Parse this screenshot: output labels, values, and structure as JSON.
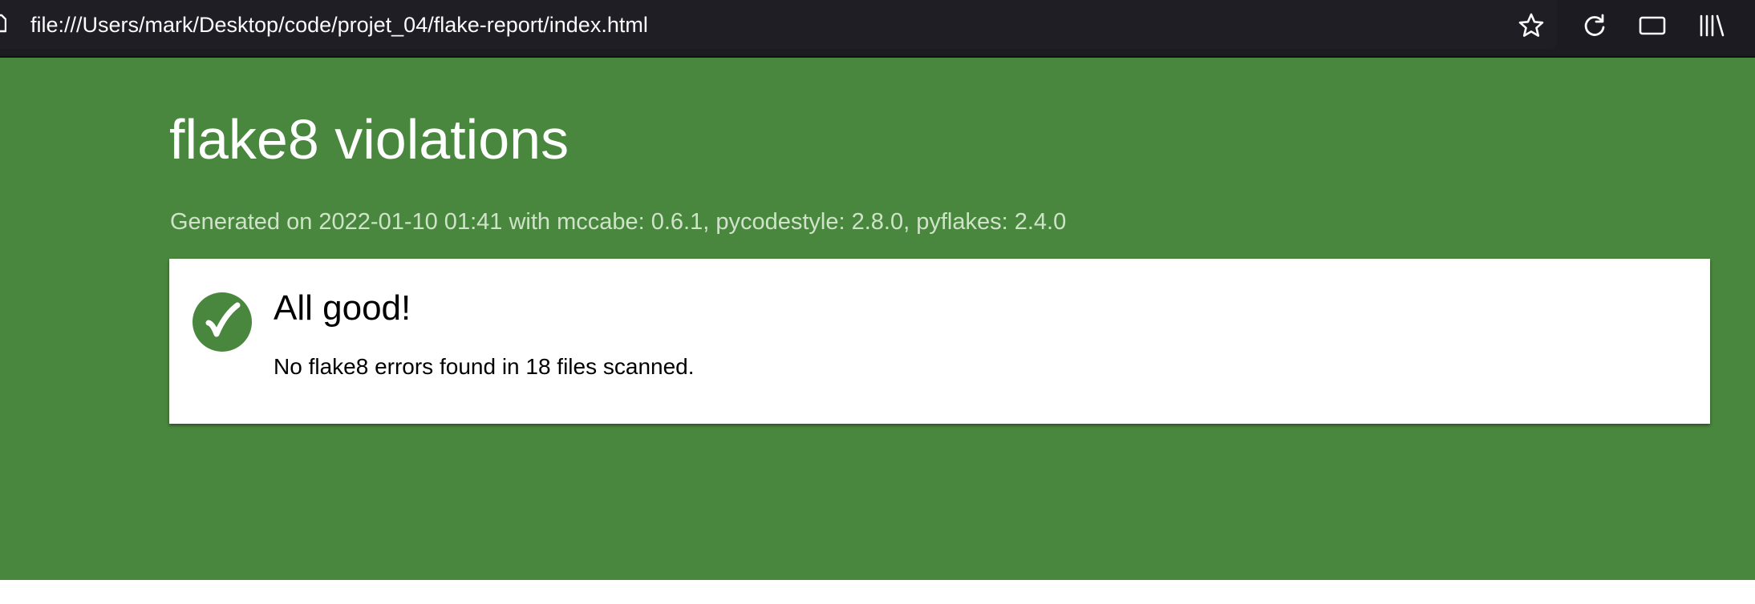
{
  "browser": {
    "url": "file:///Users/mark/Desktop/code/projet_04/flake-report/index.html",
    "icons": {
      "page": "page-icon",
      "bookmark": "star-icon",
      "reload": "reload-icon",
      "reader": "reader-view-icon",
      "library": "library-icon"
    }
  },
  "report": {
    "title": "flake8 violations",
    "meta": "Generated on 2022-01-10 01:41 with mccabe: 0.6.1, pycodestyle: 2.8.0, pyflakes: 2.4.0",
    "accent_color": "#4a873e",
    "result": {
      "icon": "checkmark-icon",
      "heading": "All good!",
      "message": "No flake8 errors found in 18 files scanned."
    }
  }
}
